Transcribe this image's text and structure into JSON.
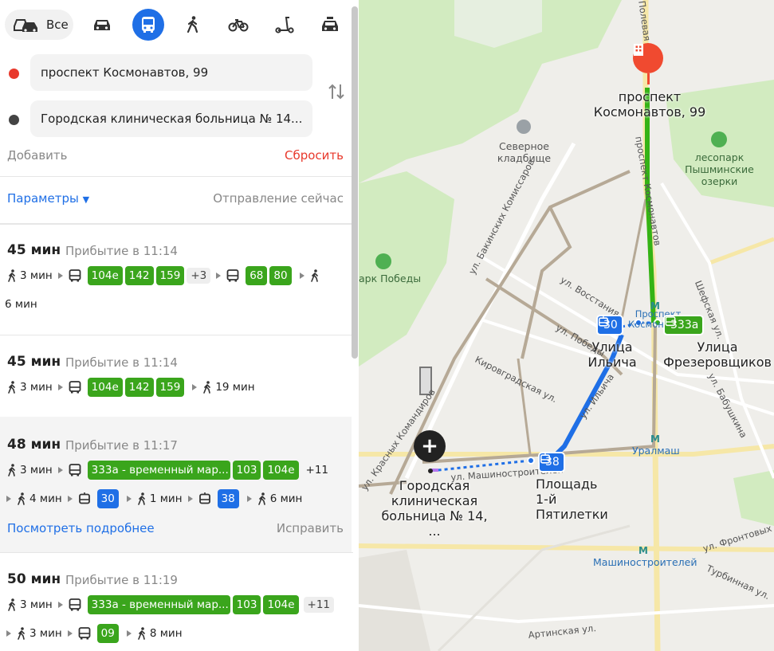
{
  "modes": {
    "all_label": "Все",
    "items": [
      "car-icon",
      "bus-icon",
      "walk-icon",
      "bike-icon",
      "scooter-icon",
      "taxi-icon"
    ],
    "active": "bus-icon"
  },
  "from_value": "проспект Космонавтов, 99",
  "to_value": "Городская клиническая больница № 14...",
  "add_label": "Добавить",
  "reset_label": "Сбросить",
  "params_label": "Параметры",
  "departure_label": "Отправление сейчас",
  "routes": [
    {
      "time": "45 мин",
      "arrival": "Прибытие в 11:14",
      "walk1": "3 мин",
      "buses1": [
        "104е",
        "142",
        "159"
      ],
      "more1": "+3",
      "buses2": [
        "68",
        "80"
      ],
      "walk_end": "6 мин"
    },
    {
      "time": "45 мин",
      "arrival": "Прибытие в 11:14",
      "walk1": "3 мин",
      "buses1": [
        "104е",
        "142",
        "159"
      ],
      "walk_end": "19 мин"
    },
    {
      "time": "48 мин",
      "arrival": "Прибытие в 11:17",
      "walk1": "3 мин",
      "buses1": [
        "333а - временный мар...",
        "103",
        "104е"
      ],
      "more1": "+11",
      "walk2": "4 мин",
      "tram1": "30",
      "walk3": "1 мин",
      "tram2": "38",
      "walk_end": "6 мин",
      "details_label": "Посмотреть подробнее",
      "fix_label": "Исправить"
    },
    {
      "time": "50 мин",
      "arrival": "Прибытие в 11:19",
      "walk1": "3 мин",
      "buses1": [
        "333а - временный мар...",
        "103",
        "104е"
      ],
      "more1": "+11",
      "walk2": "3 мин",
      "bus2": "09",
      "walk_end": "8 мин"
    }
  ],
  "map": {
    "start_label": "проспект\nКосмонавтов, 99",
    "end_label": "Городская\nклиническая\nбольница № 14, ...",
    "places": {
      "cemetery": "Северное\nкладбище",
      "forest": "лесопарк\nПышминские\nозерки",
      "park": "арк Победы",
      "stop1": "Улица\nИльича",
      "stop2": "Улица\nФрезеровщиков",
      "stop3": "Площадь\n1-й\nПятилетки",
      "metro1": "Проспект\nКосмонавтов",
      "metro2": "Уралмаш",
      "metro3": "Машиностроителей"
    },
    "streets": {
      "s1": "ул. Бакинских Комиссаров",
      "s2": "ул. Восстания",
      "s3": "ул. Победы",
      "s4": "Кировградская ул.",
      "s5": "ул. Ильича",
      "s6": "ул. Машиностроителей",
      "s7": "Шефская ул.",
      "s8": "ул. Фронтовых Бригад",
      "s9": "Турбинная ул.",
      "s10": "Артинская ул.",
      "s11": "проспект Космонавтов",
      "s12": "ул. Бабушкина",
      "s13": "ул. Красных Командиров",
      "s14": "Полевая"
    },
    "badges": {
      "tram_30": "30",
      "bus_333a": "333а",
      "tram_38": "38"
    },
    "colors": {
      "green_route": "#35b315",
      "blue_route": "#1f6fe6",
      "walk_route": "#b6a996",
      "red_pin": "#f04a30"
    }
  }
}
